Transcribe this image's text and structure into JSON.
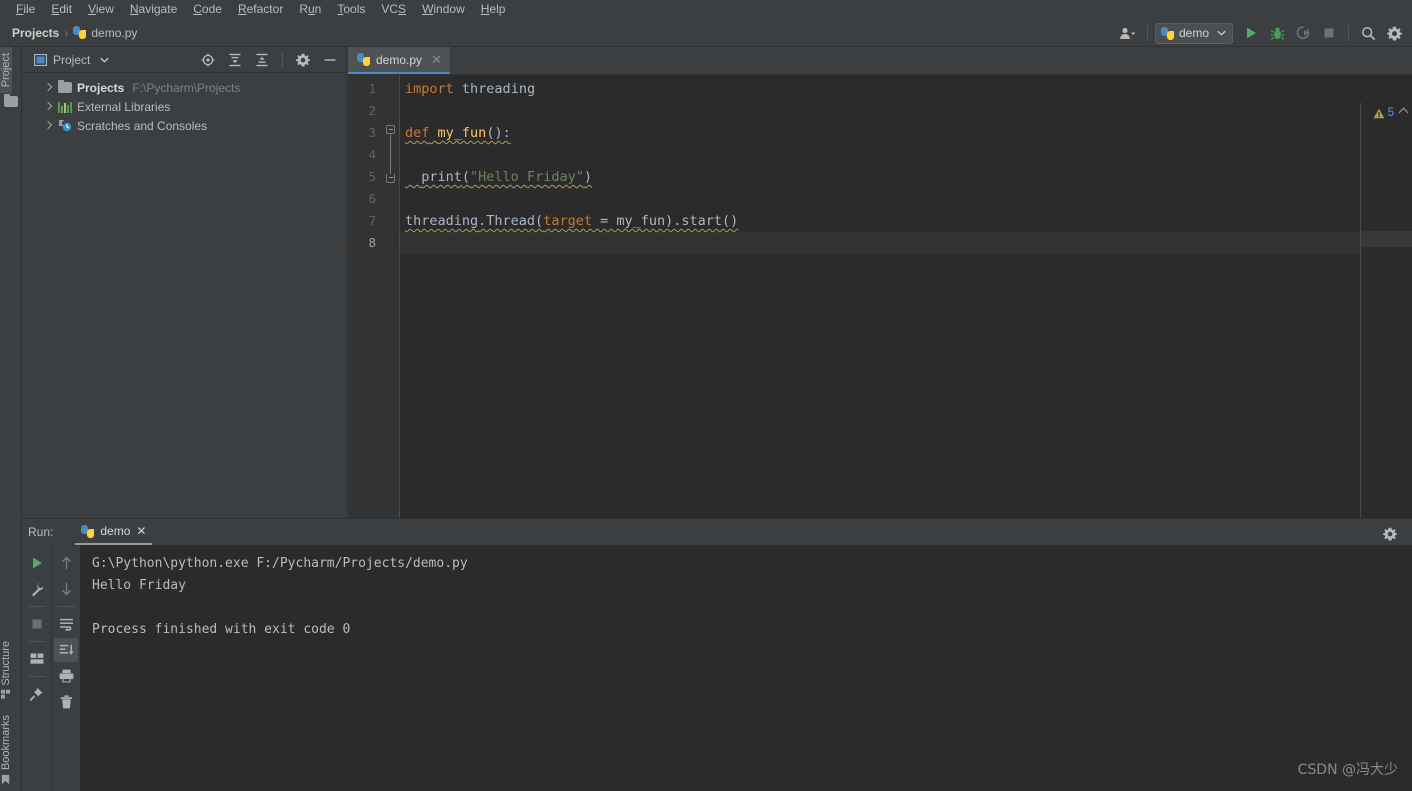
{
  "menubar": {
    "items": [
      {
        "label": "File",
        "mnemonic": "F"
      },
      {
        "label": "Edit",
        "mnemonic": "E"
      },
      {
        "label": "View",
        "mnemonic": "V"
      },
      {
        "label": "Navigate",
        "mnemonic": "N"
      },
      {
        "label": "Code",
        "mnemonic": "C"
      },
      {
        "label": "Refactor",
        "mnemonic": "R"
      },
      {
        "label": "Run",
        "mnemonic": "u"
      },
      {
        "label": "Tools",
        "mnemonic": "T"
      },
      {
        "label": "VCS",
        "mnemonic": "S"
      },
      {
        "label": "Window",
        "mnemonic": "W"
      },
      {
        "label": "Help",
        "mnemonic": "H"
      }
    ]
  },
  "breadcrumb": {
    "root": "Projects",
    "separator": "›",
    "file": "demo.py",
    "file_icon": "python-file-icon"
  },
  "toolbar": {
    "user_icon": "user-avatar-icon",
    "user_dropdown_icon": "chevron-down-icon",
    "run_config": {
      "icon": "python-file-icon",
      "name": "demo",
      "dropdown_icon": "chevron-down-icon"
    },
    "buttons": [
      {
        "name": "run-button",
        "icon": "play-icon",
        "color": "#59a869"
      },
      {
        "name": "debug-button",
        "icon": "bug-icon",
        "color": "#499c54"
      },
      {
        "name": "run-with-coverage-button",
        "icon": "coverage-icon",
        "color": "#6e7275"
      },
      {
        "name": "stop-button",
        "icon": "stop-square-icon",
        "color": "#6e7275"
      },
      {
        "name": "search-everywhere-button",
        "icon": "search-icon",
        "color": "#b9b9b9"
      },
      {
        "name": "settings-button",
        "icon": "gear-icon",
        "color": "#b9b9b9"
      }
    ]
  },
  "left_strip": {
    "top": [
      {
        "label": "Project",
        "icon": "folder-icon",
        "selected": true
      }
    ],
    "bottom": [
      {
        "label": "Structure",
        "icon": "structure-icon",
        "selected": false
      },
      {
        "label": "Bookmarks",
        "icon": "bookmark-icon",
        "selected": false
      }
    ]
  },
  "project_panel": {
    "title": "Project",
    "title_icon": "project-window-icon",
    "dropdown_icon": "chevron-down-icon",
    "header_buttons": [
      {
        "name": "select-opened-file-button",
        "icon": "locate-target-icon"
      },
      {
        "name": "expand-all-button",
        "icon": "expand-all-icon"
      },
      {
        "name": "collapse-all-button",
        "icon": "collapse-all-icon"
      },
      {
        "name": "panel-settings-button",
        "icon": "gear-icon"
      },
      {
        "name": "hide-panel-button",
        "icon": "minus-icon"
      }
    ],
    "tree": [
      {
        "label": "Projects",
        "path": "F:\\Pycharm\\Projects",
        "icon": "folder-icon",
        "bold": true,
        "expanded": false
      },
      {
        "label": "External Libraries",
        "path": "",
        "icon": "library-icon",
        "bold": false,
        "expanded": false
      },
      {
        "label": "Scratches and Consoles",
        "path": "",
        "icon": "scratches-icon",
        "bold": false,
        "expanded": false
      }
    ]
  },
  "editor": {
    "tabs": [
      {
        "label": "demo.py",
        "icon": "python-file-icon",
        "active": true,
        "close_icon": "close-icon"
      }
    ],
    "line_numbers": [
      "1",
      "2",
      "3",
      "4",
      "5",
      "6",
      "7",
      "8"
    ],
    "current_line": 8,
    "inspection": {
      "icon": "warning-triangle-icon",
      "count": "5",
      "collapse_icon": "chevron-up-icon"
    },
    "code_lines": [
      {
        "n": 1,
        "tokens": [
          {
            "t": "import",
            "c": "k-kw"
          },
          {
            "t": " ",
            "c": "k-id"
          },
          {
            "t": "threading",
            "c": "k-id"
          }
        ]
      },
      {
        "n": 2,
        "tokens": []
      },
      {
        "n": 3,
        "tokens": [
          {
            "t": "def",
            "c": "k-kw"
          },
          {
            "t": " ",
            "c": "k-id"
          },
          {
            "t": "my_fun",
            "c": "k-fn"
          },
          {
            "t": "():",
            "c": "k-id"
          }
        ]
      },
      {
        "n": 4,
        "tokens": []
      },
      {
        "n": 5,
        "tokens": [
          {
            "t": "  ",
            "c": "k-id"
          },
          {
            "t": "print",
            "c": "k-id"
          },
          {
            "t": "(",
            "c": "k-id"
          },
          {
            "t": "\"Hello Friday\"",
            "c": "k-str"
          },
          {
            "t": ")",
            "c": "k-id"
          }
        ]
      },
      {
        "n": 6,
        "tokens": []
      },
      {
        "n": 7,
        "tokens": [
          {
            "t": "threading",
            "c": "k-id"
          },
          {
            "t": ".Thread(",
            "c": "k-id"
          },
          {
            "t": "target",
            "c": "k-arg"
          },
          {
            "t": " = my_fun).start()",
            "c": "k-id"
          }
        ]
      },
      {
        "n": 8,
        "tokens": []
      }
    ]
  },
  "run_panel": {
    "label": "Run:",
    "tab": {
      "label": "demo",
      "icon": "python-file-icon",
      "close_icon": "close-icon"
    },
    "settings_icon": "gear-icon",
    "tools_left": [
      {
        "name": "rerun-button",
        "icon": "play-icon",
        "color": "#59a869"
      },
      {
        "name": "edit-configuration-button",
        "icon": "wrench-icon",
        "color": "#afb1b3"
      },
      {
        "name": "stop-process-button",
        "icon": "stop-square-icon",
        "color": "#6e7275"
      },
      {
        "name": "layout-settings-button",
        "icon": "layout-icon",
        "color": "#afb1b3"
      },
      {
        "name": "pin-tab-button",
        "icon": "pin-icon",
        "color": "#afb1b3"
      }
    ],
    "tools_right": [
      {
        "name": "scroll-up-button",
        "icon": "arrow-up-icon",
        "color": "#7a7d80"
      },
      {
        "name": "scroll-down-button",
        "icon": "arrow-down-icon",
        "color": "#7a7d80"
      },
      {
        "name": "soft-wrap-button",
        "icon": "soft-wrap-icon",
        "color": "#afb1b3"
      },
      {
        "name": "scroll-to-end-button",
        "icon": "scroll-to-end-icon",
        "color": "#afb1b3",
        "active": true
      },
      {
        "name": "print-button",
        "icon": "printer-icon",
        "color": "#afb1b3"
      },
      {
        "name": "clear-all-button",
        "icon": "trash-icon",
        "color": "#afb1b3"
      }
    ],
    "console_lines": [
      "G:\\Python\\python.exe F:/Pycharm/Projects/demo.py",
      "Hello Friday",
      "",
      "Process finished with exit code 0"
    ]
  },
  "watermark": "CSDN @冯大少",
  "colors": {
    "window_bg": "#3c3f41",
    "editor_bg": "#2b2b2b",
    "gutter_bg": "#313335",
    "accent_blue": "#4a88c7",
    "keyword_orange": "#cc7832",
    "string_green": "#6a8759",
    "function_yellow": "#ffc66d",
    "identifier": "#a9b7c6",
    "run_green": "#59a869"
  }
}
